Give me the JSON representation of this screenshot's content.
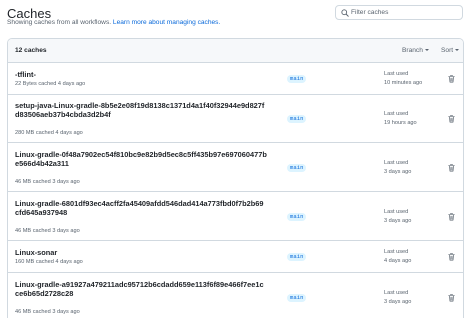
{
  "header": {
    "title": "Caches",
    "subtitle": "Showing caches from all workflows. ",
    "subtitle_link": "Learn more about managing caches."
  },
  "search": {
    "placeholder": "Filter caches",
    "value": "",
    "icon": "search-icon"
  },
  "list": {
    "count_label": "12 caches",
    "branch_label": "Branch",
    "sort_label": "Sort",
    "last_used_label": "Last used",
    "rows": [
      {
        "name": "-tflint-",
        "meta": "22 Bytes cached 4 days ago",
        "branch": "main",
        "last_used": "10 minutes ago"
      },
      {
        "name": "setup-java-Linux-gradle-8b5e2e08f19d8138c1371d4a1f40f32944e9d827fd83506aeb37b4cbda3d2b4f",
        "meta": "280 MB cached 4 days ago",
        "branch": "main",
        "last_used": "19 hours ago"
      },
      {
        "name": "Linux-gradle-0f48a7902ec54f810bc9e82b9d5ec8c5ff435b97e697060477be566d4b42a311",
        "meta": "46 MB cached 3 days ago",
        "branch": "main",
        "last_used": "3 days ago"
      },
      {
        "name": "Linux-gradle-6801df93ec4acff2fa45409afdd546dad414a773fbd0f7b2b69cfd645a937948",
        "meta": "46 MB cached 3 days ago",
        "branch": "main",
        "last_used": "3 days ago"
      },
      {
        "name": "Linux-sonar",
        "meta": "160 MB cached 4 days ago",
        "branch": "main",
        "last_used": "4 days ago"
      },
      {
        "name": "Linux-gradle-a91927a479211adc95712b6cdadd659e113f6f89e466f7ee1cce6b65d2728c28",
        "meta": "46 MB cached 3 days ago",
        "branch": "main",
        "last_used": "3 days ago"
      }
    ]
  }
}
